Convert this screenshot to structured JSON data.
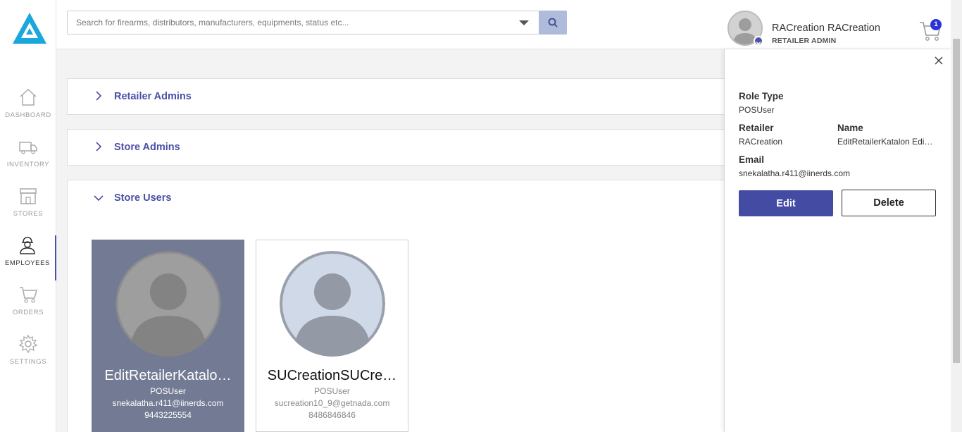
{
  "search": {
    "placeholder": "Search for firearms, distributors, manufacturers, equipments, status etc..."
  },
  "header": {
    "user_name": "RACreation RACreation",
    "user_role": "RETAILER ADMIN",
    "cart_count": "1"
  },
  "sidebar": {
    "items": [
      {
        "label": "DASHBOARD",
        "icon": "home-icon"
      },
      {
        "label": "INVENTORY",
        "icon": "truck-icon"
      },
      {
        "label": "STORES",
        "icon": "store-icon"
      },
      {
        "label": "EMPLOYEES",
        "icon": "employee-icon",
        "active": true
      },
      {
        "label": "ORDERS",
        "icon": "cart-icon"
      },
      {
        "label": "SETTINGS",
        "icon": "gear-icon"
      }
    ]
  },
  "sections": [
    {
      "title": "Retailer Admins",
      "expanded": false
    },
    {
      "title": "Store Admins",
      "expanded": false
    },
    {
      "title": "Store Users",
      "expanded": true
    }
  ],
  "users": [
    {
      "name": "EditRetailerKatalo…",
      "role": "POSUser",
      "email": "snekalatha.r411@iinerds.com",
      "phone": "9443225554",
      "selected": true
    },
    {
      "name": "SUCreationSUCre…",
      "role": "POSUser",
      "email": "sucreation10_9@getnada.com",
      "phone": "8486846846",
      "selected": false
    }
  ],
  "panel": {
    "role_type_label": "Role Type",
    "role_type_value": "POSUser",
    "retailer_label": "Retailer",
    "retailer_value": "RACreation",
    "name_label": "Name",
    "name_value": "EditRetailerKatalon Edi…",
    "email_label": "Email",
    "email_value": "snekalatha.r411@iinerds.com",
    "edit_label": "Edit",
    "delete_label": "Delete"
  },
  "colors": {
    "accent": "#4b50a6",
    "logo": "#1aa7dc",
    "selected_card": "#737b94"
  }
}
